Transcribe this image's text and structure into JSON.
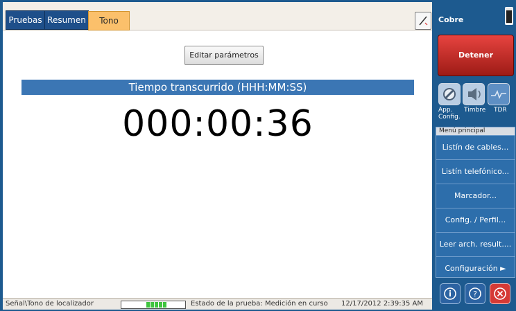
{
  "tabs": [
    {
      "label": "Pruebas"
    },
    {
      "label": "Resumen"
    },
    {
      "label": "Tono",
      "active": true
    }
  ],
  "edit_button": "Editar parámetros",
  "banner": "Tiempo transcurrido (HHH:MM:SS)",
  "timer": "000:00:36",
  "status": {
    "path": "Señal\\Tono de localizador",
    "progress_fraction": 1.0,
    "state": "Estado de la prueba: Medición en curso",
    "datetime": "12/17/2012 2:39:35 AM"
  },
  "right": {
    "title": "Cobre",
    "stop_button": "Detener",
    "icons": [
      {
        "label": "App. Config.",
        "icon": "config-tool-icon"
      },
      {
        "label": "Timbre",
        "icon": "speaker-icon"
      },
      {
        "label": "TDR",
        "icon": "tdr-waveform-icon"
      }
    ],
    "menu_title": "Menú principal",
    "menu": [
      "Listín de cables...",
      "Listín telefónico...",
      "Marcador...",
      "Config. / Perfil...",
      "Leer arch. result....",
      "Configuración ►"
    ]
  },
  "colors": {
    "accent_tab": "#fbc06b",
    "stop": "#c62d28",
    "banner": "#3b76b4"
  }
}
